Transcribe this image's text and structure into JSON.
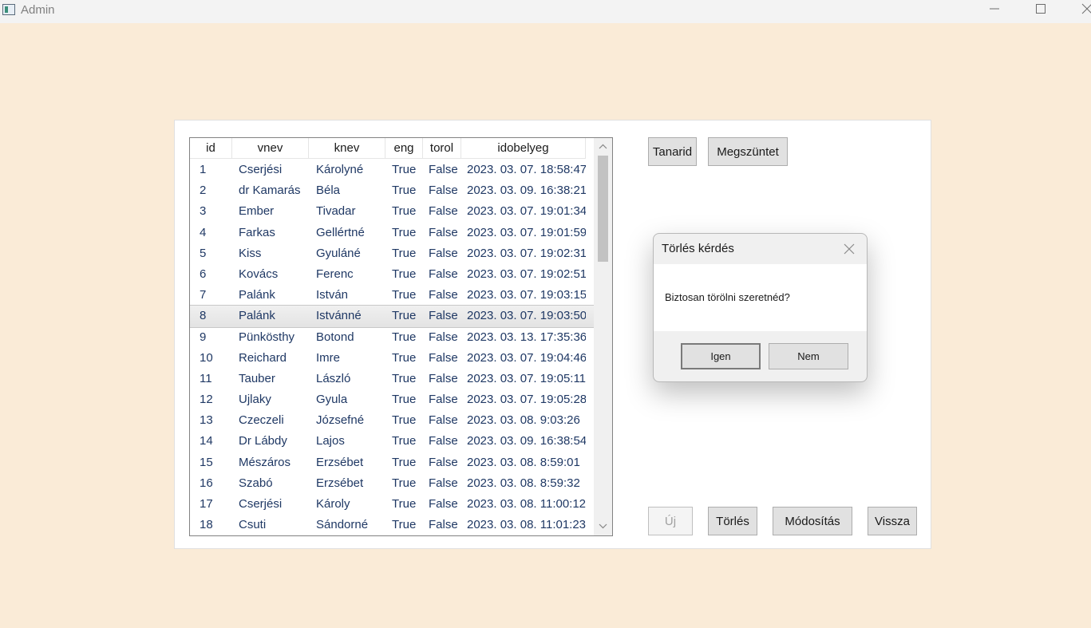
{
  "window": {
    "title": "Admin",
    "icons": [
      "app-icon",
      "minimize-icon",
      "maximize-icon",
      "close-icon"
    ]
  },
  "grid": {
    "columns": [
      "id",
      "vnev",
      "knev",
      "eng",
      "torol",
      "idobelyeg"
    ],
    "selected_row": 8,
    "rows": [
      [
        "1",
        "Cserjési",
        "Károlyné",
        "True",
        "False",
        "2023. 03. 07. 18:58:47"
      ],
      [
        "2",
        "dr Kamarás",
        "Béla",
        "True",
        "False",
        "2023. 03. 09. 16:38:21"
      ],
      [
        "3",
        "Ember",
        "Tivadar",
        "True",
        "False",
        "2023. 03. 07. 19:01:34"
      ],
      [
        "4",
        "Farkas",
        "Gellértné",
        "True",
        "False",
        "2023. 03. 07. 19:01:59"
      ],
      [
        "5",
        "Kiss",
        "Gyuláné",
        "True",
        "False",
        "2023. 03. 07. 19:02:31"
      ],
      [
        "6",
        "Kovács",
        "Ferenc",
        "True",
        "False",
        "2023. 03. 07. 19:02:51"
      ],
      [
        "7",
        "Palánk",
        "István",
        "True",
        "False",
        "2023. 03. 07. 19:03:15"
      ],
      [
        "8",
        "Palánk",
        "Istvánné",
        "True",
        "False",
        "2023. 03. 07. 19:03:50"
      ],
      [
        "9",
        "Pünkösthy",
        "Botond",
        "True",
        "False",
        "2023. 03. 13. 17:35:36"
      ],
      [
        "10",
        "Reichard",
        "Imre",
        "True",
        "False",
        "2023. 03. 07. 19:04:46"
      ],
      [
        "11",
        "Tauber",
        "László",
        "True",
        "False",
        "2023. 03. 07. 19:05:11"
      ],
      [
        "12",
        "Ujlaky",
        "Gyula",
        "True",
        "False",
        "2023. 03. 07. 19:05:28"
      ],
      [
        "13",
        "Czeczeli",
        "Józsefné",
        "True",
        "False",
        "2023. 03. 08. 9:03:26"
      ],
      [
        "14",
        "Dr Lábdy",
        "Lajos",
        "True",
        "False",
        "2023. 03. 09. 16:38:54"
      ],
      [
        "15",
        "Mészáros",
        "Erzsébet",
        "True",
        "False",
        "2023. 03. 08. 8:59:01"
      ],
      [
        "16",
        "Szabó",
        "Erzsébet",
        "True",
        "False",
        "2023. 03. 08. 8:59:32"
      ],
      [
        "17",
        "Cserjési",
        "Károly",
        "True",
        "False",
        "2023. 03. 08. 11:00:12"
      ],
      [
        "18",
        "Csuti",
        "Sándorné",
        "True",
        "False",
        "2023. 03. 08. 11:01:23"
      ]
    ]
  },
  "buttons": {
    "tanarid": "Tanarid",
    "megszuntet": "Megszüntet",
    "uj": "Új",
    "torles": "Törlés",
    "modositas": "Módosítás",
    "vissza": "Vissza"
  },
  "dialog": {
    "title": "Törlés kérdés",
    "message": "Biztosan törölni szeretnéd?",
    "yes": "Igen",
    "no": "Nem"
  },
  "colors": {
    "background": "#faebd7",
    "cell_text": "#1f3864",
    "button_face": "#e1e1e1"
  }
}
